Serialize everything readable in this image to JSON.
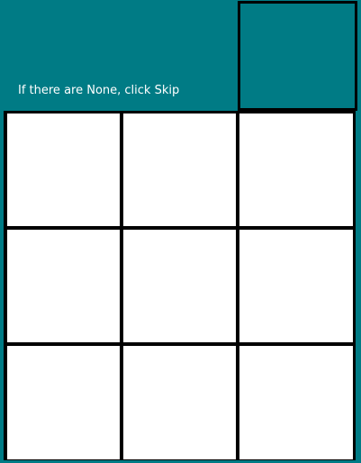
{
  "header": {
    "instruction": "If there are None, click Skip",
    "background_color": "#007b85"
  },
  "sample_image": {
    "background_color": "#007b85"
  },
  "grid": {
    "rows": 3,
    "columns": 3,
    "tile_color": "#ffffff",
    "tiles": [
      {
        "id": "tile-1"
      },
      {
        "id": "tile-2"
      },
      {
        "id": "tile-3"
      },
      {
        "id": "tile-4"
      },
      {
        "id": "tile-5"
      },
      {
        "id": "tile-6"
      },
      {
        "id": "tile-7"
      },
      {
        "id": "tile-8"
      },
      {
        "id": "tile-9"
      }
    ]
  }
}
